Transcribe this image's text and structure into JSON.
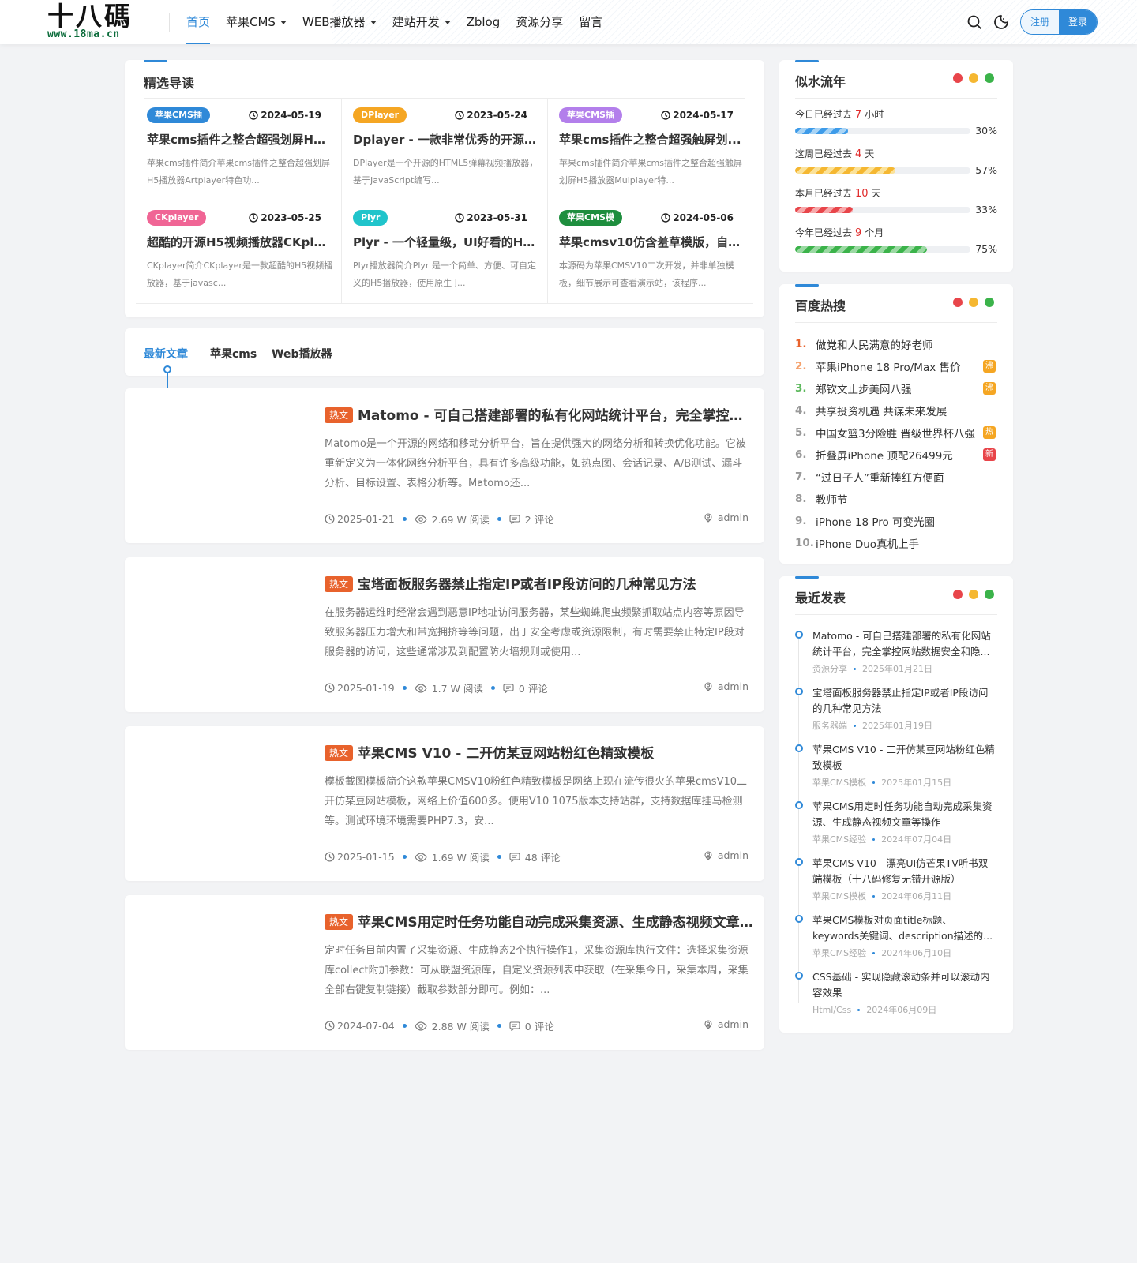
{
  "header": {
    "logo_cn": "十八碼",
    "logo_en": "www.18ma.cn",
    "nav": [
      {
        "label": "首页"
      },
      {
        "label": "苹果CMS"
      },
      {
        "label": "WEB播放器"
      },
      {
        "label": "建站开发"
      },
      {
        "label": "Zblog"
      },
      {
        "label": "资源分享"
      },
      {
        "label": "留言"
      }
    ],
    "register_label": "注册",
    "login_label": "登录"
  },
  "featured": {
    "title": "精选导读",
    "items": [
      {
        "tag": "苹果CMS插",
        "tag_color": "#2f89d8",
        "date": "2024-05-19",
        "title": "苹果cms插件之整合超强划屏H5...",
        "desc": "苹果cms插件简介苹果cms插件之整合超强划屏H5播放器Artplayer特色功..."
      },
      {
        "tag": "DPlayer",
        "tag_color": "#f5a623",
        "date": "2023-05-24",
        "title": "Dplayer - 一款非常优秀的开源弹...",
        "desc": "DPlayer是一个开源的HTML5弹幕视频播放器，基于JavaScript编写..."
      },
      {
        "tag": "苹果CMS插",
        "tag_color": "#b37feb",
        "date": "2024-05-17",
        "title": "苹果cms插件之整合超强触屏划...",
        "desc": "苹果cms插件简介苹果cms插件之整合超强触屏划屏H5播放器Muiplayer特..."
      },
      {
        "tag": "CKplayer",
        "tag_color": "#f06595",
        "date": "2023-05-25",
        "title": "超酷的开源H5视频播放器CKpla...",
        "desc": "CKplayer简介CKplayer是一款超酷的H5视频播放器，基于javasc..."
      },
      {
        "tag": "Plyr",
        "tag_color": "#20c4cb",
        "date": "2023-05-31",
        "title": "Plyr - 一个轻量级，UI好看的H5 ...",
        "desc": "Plyr播放器简介Plyr 是一个简单、方便、可自定义的H5播放器，使用原生 J..."
      },
      {
        "tag": "苹果CMS模",
        "tag_color": "#1e8e3e",
        "date": "2024-05-06",
        "title": "苹果cmsv10仿含羞草模版，自适...",
        "desc": "本源码为苹果CMSV10二次开发，并非单独模板，细节展示可查看演示站，该程序..."
      }
    ]
  },
  "tabs": [
    {
      "label": "最新文章"
    },
    {
      "label": "苹果cms"
    },
    {
      "label": "Web播放器"
    }
  ],
  "articles": [
    {
      "badge": "热文",
      "title": "Matomo - 可自己搭建部署的私有化网站统计平台，完全掌控网站数据安全和隐私",
      "desc": "Matomo是一个开源的网络和移动分析平台，旨在提供强大的网络分析和转换优化功能。它被重新定义为一体化网络分析平台，具有许多高级功能，如热点图、会话记录、A/B测试、漏斗分析、目标设置、表格分析等。Matomo还...",
      "date": "2025-01-21",
      "views": "2.69 W 阅读",
      "comments": "2 评论",
      "author": "admin"
    },
    {
      "badge": "热文",
      "title": "宝塔面板服务器禁止指定IP或者IP段访问的几种常见方法",
      "desc": "在服务器运维时经常会遇到恶意IP地址访问服务器，某些蜘蛛爬虫频繁抓取站点内容等原因导致服务器压力增大和带宽拥挤等等问题，出于安全考虑或资源限制，有时需要禁止特定IP段对服务器的访问，这些通常涉及到配置防火墙规则或使用...",
      "date": "2025-01-19",
      "views": "1.7 W 阅读",
      "comments": "0 评论",
      "author": "admin"
    },
    {
      "badge": "热文",
      "title": "苹果CMS V10 - 二开仿某豆网站粉红色精致模板",
      "desc": "模板截图模板简介这款苹果CMSV10粉红色精致模板是网络上现在流传很火的苹果cmsV10二开仿某豆网站模板，网络上价值600多。使用V10 1075版本支持站群，支持数据库挂马检测等。测试环境环境需要PHP7.3，安...",
      "date": "2025-01-15",
      "views": "1.69 W 阅读",
      "comments": "48 评论",
      "author": "admin"
    },
    {
      "badge": "热文",
      "title": "苹果CMS用定时任务功能自动完成采集资源、生成静态视频文章等操作",
      "desc": "定时任务目前内置了采集资源、生成静态2个执行操作1，采集资源库执行文件：选择采集资源库collect附加参数：可从联盟资源库，自定义资源列表中获取（在采集今日，采集本周，采集全部右键复制链接）截取参数部分即可。例如：...",
      "date": "2024-07-04",
      "views": "2.88 W 阅读",
      "comments": "0 评论",
      "author": "admin"
    }
  ],
  "time_progress": {
    "title": "似水流年",
    "items": [
      {
        "prefix": "今日已经过去",
        "num": "7",
        "unit": "小时",
        "pct_label": "30%",
        "pct": 30,
        "color": "#3d9be9",
        "stripe": "#a9d4f5"
      },
      {
        "prefix": "这周已经过去",
        "num": "4",
        "unit": "天",
        "pct_label": "57%",
        "pct": 57,
        "color": "#f5b731",
        "stripe": "#fbe29a"
      },
      {
        "prefix": "本月已经过去",
        "num": "10",
        "unit": "天",
        "pct_label": "33%",
        "pct": 33,
        "color": "#e8454a",
        "stripe": "#f6a9ab"
      },
      {
        "prefix": "今年已经过去",
        "num": "9",
        "unit": "个月",
        "pct_label": "75%",
        "pct": 75,
        "color": "#3bb34a",
        "stripe": "#9bd9a3"
      }
    ]
  },
  "baidu_hot": {
    "title": "百度热搜",
    "items": [
      {
        "rank": "1.",
        "rank_color": "#e8622c",
        "text": "做党和人民满意的好老师",
        "flag": "",
        "flag_color": ""
      },
      {
        "rank": "2.",
        "rank_color": "#f5a06a",
        "text": "苹果iPhone 18 Pro/Max 售价",
        "flag": "沸",
        "flag_color": "#f5a623"
      },
      {
        "rank": "3.",
        "rank_color": "#5cb85c",
        "text": "郑钦文止步美网八强",
        "flag": "沸",
        "flag_color": "#f5a623"
      },
      {
        "rank": "4.",
        "rank_color": "#999999",
        "text": "共享投资机遇 共谋未来发展",
        "flag": "",
        "flag_color": ""
      },
      {
        "rank": "5.",
        "rank_color": "#999999",
        "text": "中国女篮3分险胜 晋级世界杯八强",
        "flag": "热",
        "flag_color": "#f5a623"
      },
      {
        "rank": "6.",
        "rank_color": "#999999",
        "text": "折叠屏iPhone 顶配26499元",
        "flag": "新",
        "flag_color": "#e8454a"
      },
      {
        "rank": "7.",
        "rank_color": "#999999",
        "text": "“过日子人”重新捧红方便面",
        "flag": "",
        "flag_color": ""
      },
      {
        "rank": "8.",
        "rank_color": "#999999",
        "text": "教师节",
        "flag": "",
        "flag_color": ""
      },
      {
        "rank": "9.",
        "rank_color": "#999999",
        "text": "iPhone 18 Pro 可变光圈",
        "flag": "",
        "flag_color": ""
      },
      {
        "rank": "10.",
        "rank_color": "#999999",
        "text": "iPhone Duo真机上手",
        "flag": "",
        "flag_color": ""
      }
    ]
  },
  "recent": {
    "title": "最近发表",
    "items": [
      {
        "title": "Matomo - 可自己搭建部署的私有化网站统计平台，完全掌控网站数据安全和隐...",
        "cat": "资源分享",
        "date": "2025年01月21日"
      },
      {
        "title": "宝塔面板服务器禁止指定IP或者IP段访问的几种常见方法",
        "cat": "服务器端",
        "date": "2025年01月19日"
      },
      {
        "title": "苹果CMS V10 - 二开仿某豆网站粉红色精致模板",
        "cat": "苹果CMS模板",
        "date": "2025年01月15日"
      },
      {
        "title": "苹果CMS用定时任务功能自动完成采集资源、生成静态视频文章等操作",
        "cat": "苹果CMS经验",
        "date": "2024年07月04日"
      },
      {
        "title": "苹果CMS V10 - 漂亮UI仿芒果TV听书双端模板（十八码修复无错开源版）",
        "cat": "苹果CMS模板",
        "date": "2024年06月11日"
      },
      {
        "title": "苹果CMS模板对页面title标题、keywords关键词、description描述的...",
        "cat": "苹果CMS经验",
        "date": "2024年06月10日"
      },
      {
        "title": "CSS基础 - 实现隐藏滚动条并可以滚动内容效果",
        "cat": "Html/Css",
        "date": "2024年06月09日"
      }
    ]
  }
}
